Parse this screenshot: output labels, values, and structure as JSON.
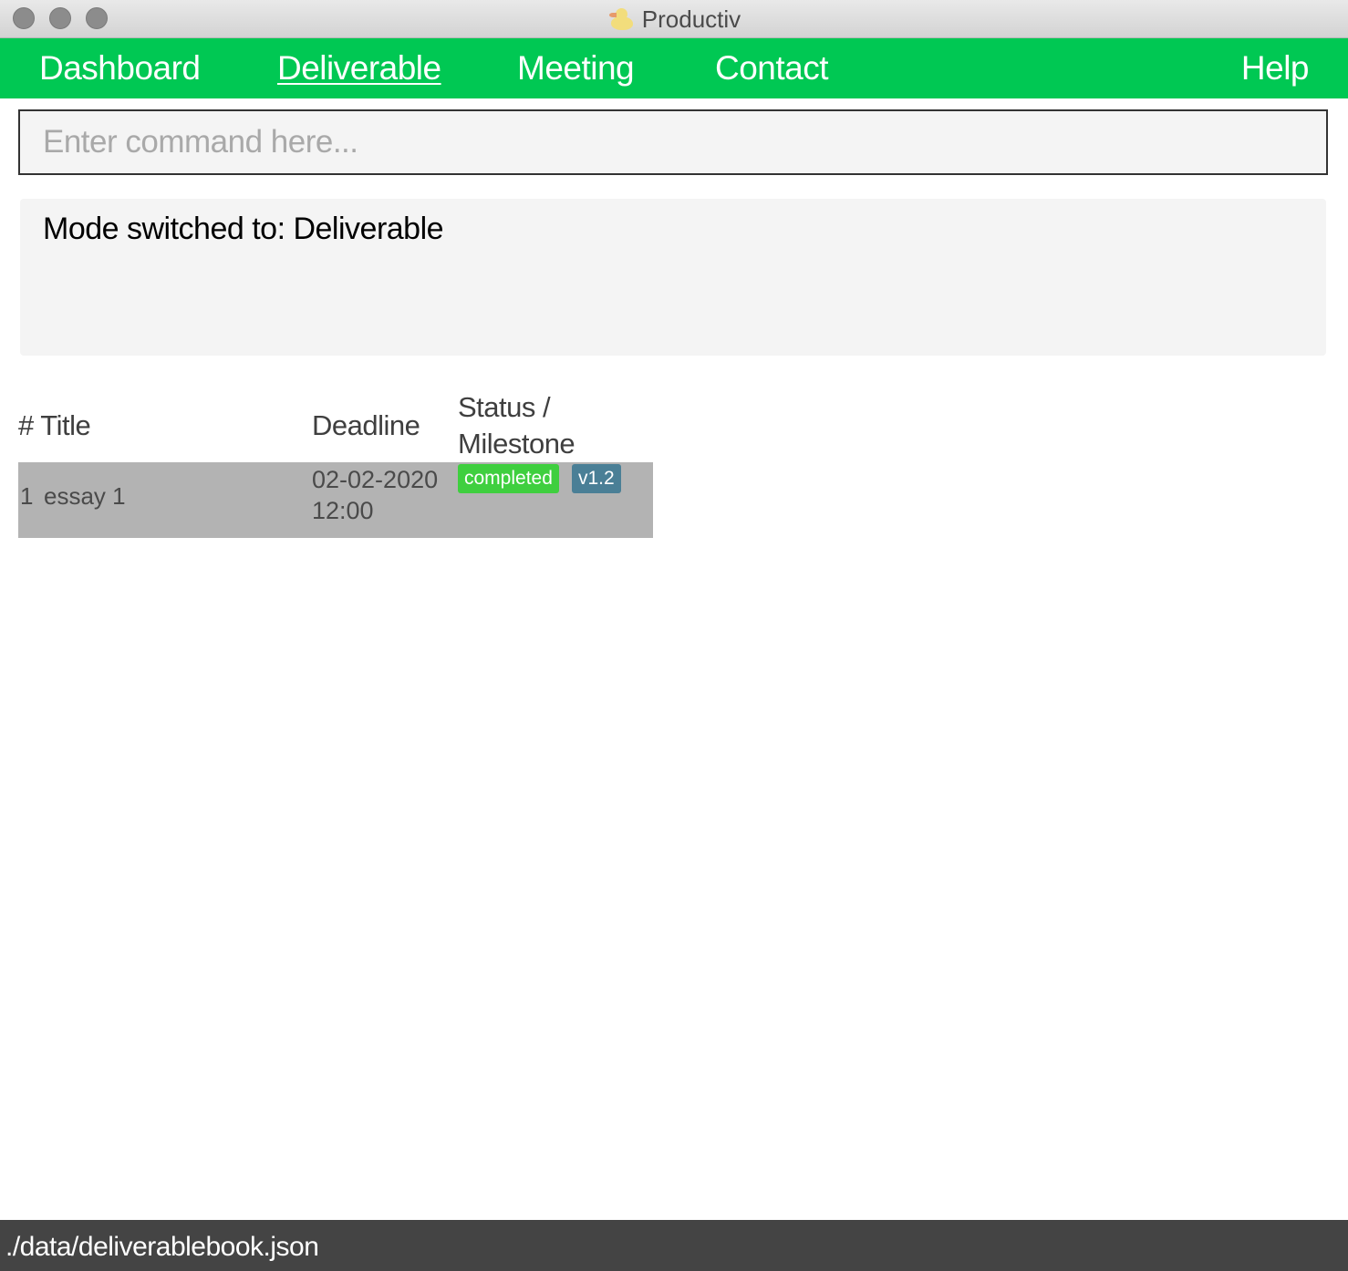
{
  "window": {
    "title": "Productiv",
    "app_icon": "duck-icon"
  },
  "nav": {
    "items": [
      {
        "label": "Dashboard",
        "active": false
      },
      {
        "label": "Deliverable",
        "active": true
      },
      {
        "label": "Meeting",
        "active": false
      },
      {
        "label": "Contact",
        "active": false
      }
    ],
    "help": "Help",
    "accent_color": "#00c853"
  },
  "command": {
    "placeholder": "Enter command here...",
    "value": ""
  },
  "result": {
    "text": "Mode switched to: Deliverable"
  },
  "table": {
    "headers": {
      "title": "# Title",
      "deadline": "Deadline",
      "status": "Status / Milestone"
    },
    "rows": [
      {
        "index": "1",
        "title": "essay 1",
        "deadline": "02-02-2020 12:00",
        "status": "completed",
        "milestone": "v1.2"
      }
    ]
  },
  "statusbar": {
    "path": "./data/deliverablebook.json"
  }
}
